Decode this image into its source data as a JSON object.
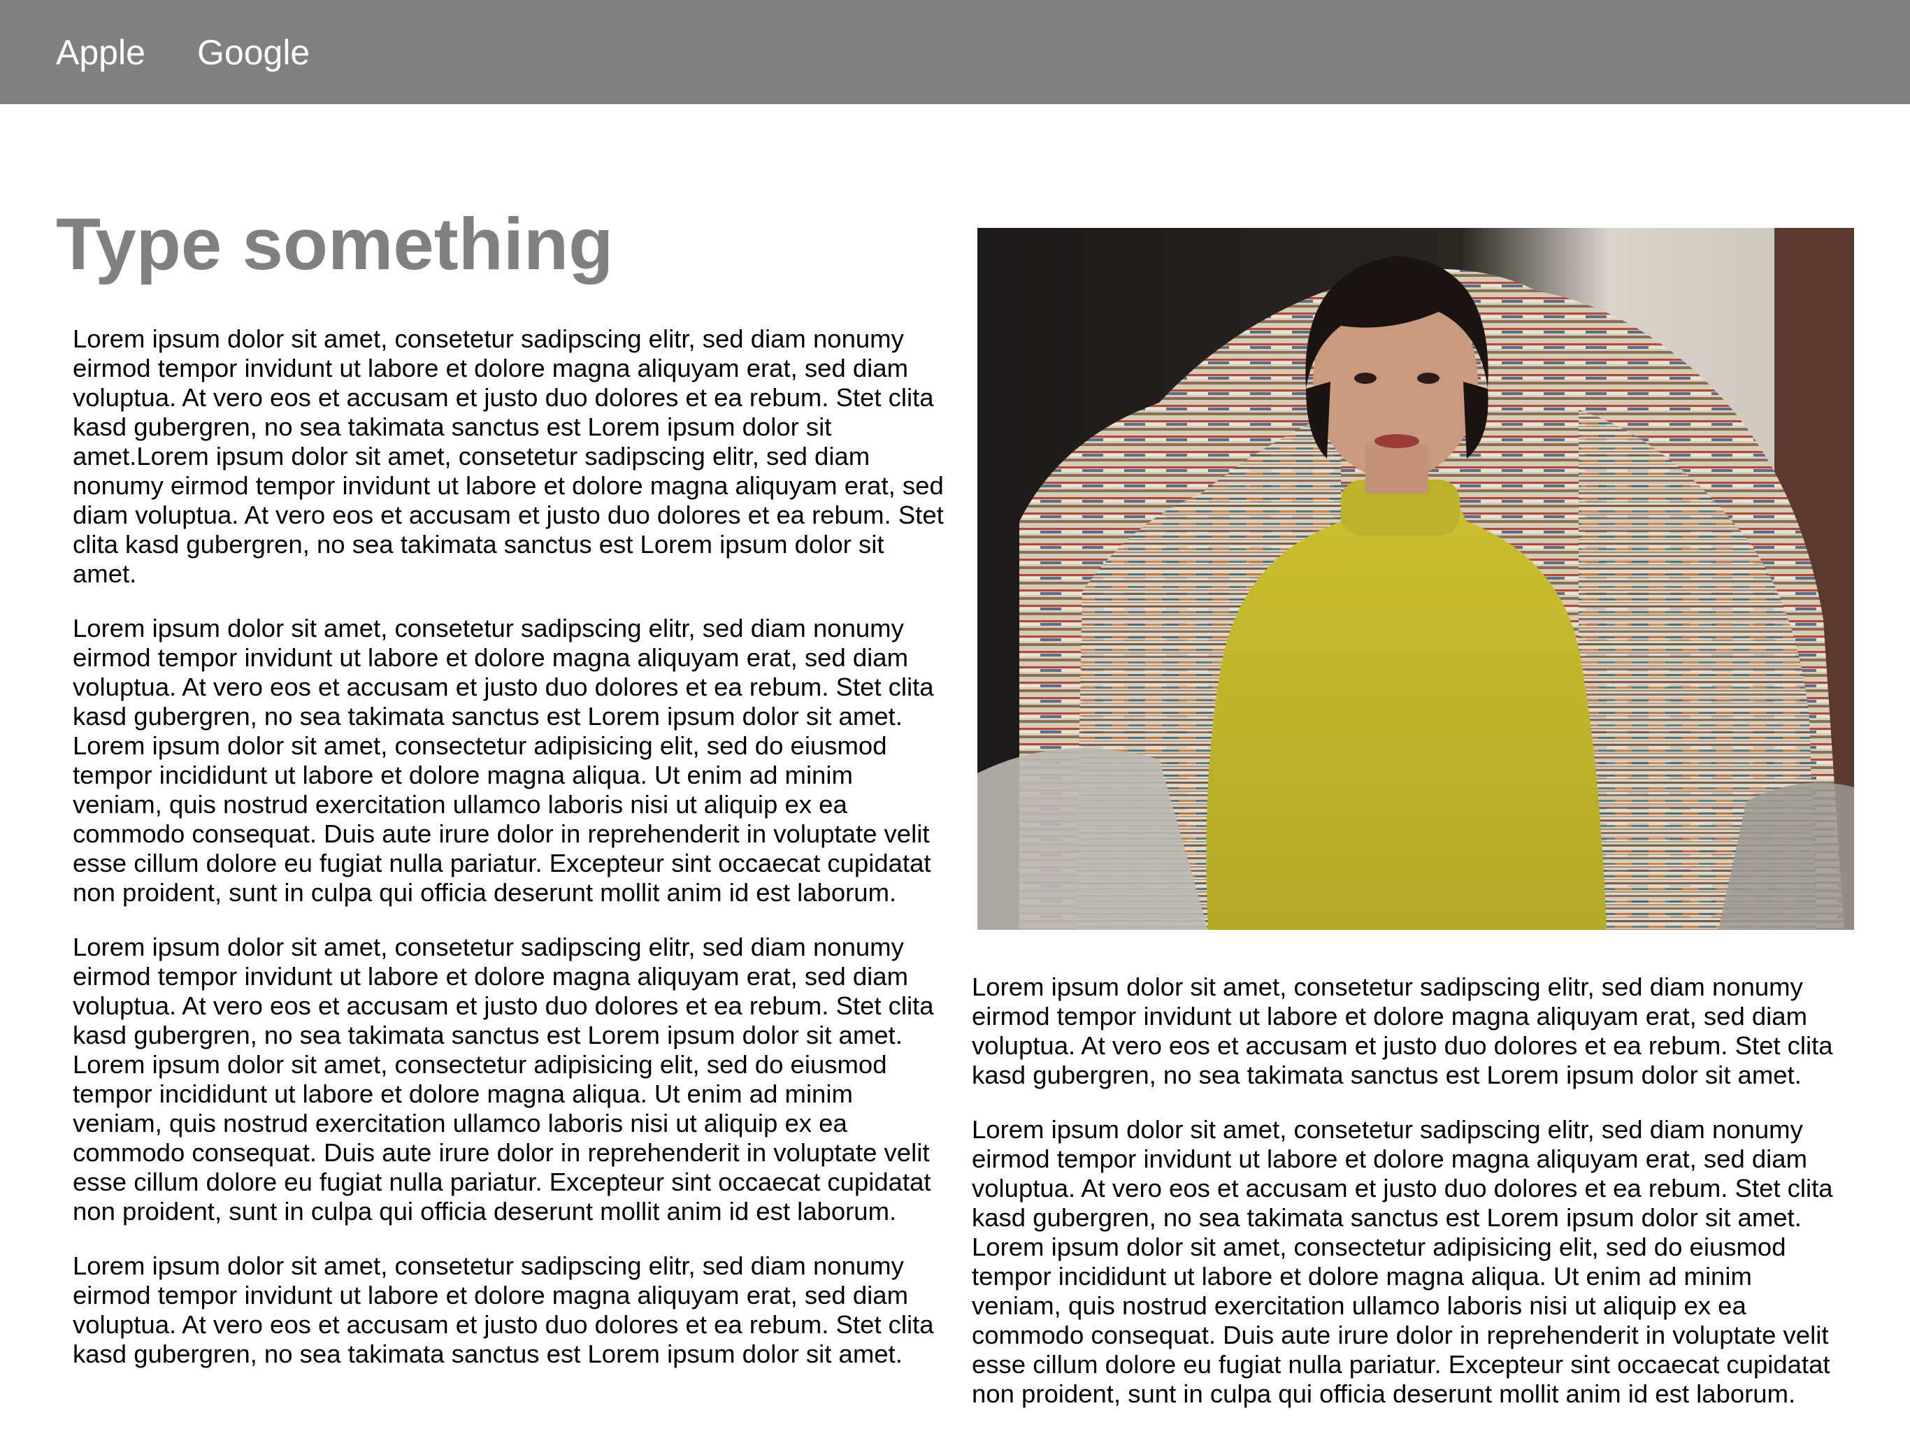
{
  "nav": {
    "links": [
      "Apple",
      "Google"
    ]
  },
  "page": {
    "title": "Type something"
  },
  "left_column": {
    "paragraphs": [
      "Lorem ipsum dolor sit amet, consetetur sadipscing elitr, sed diam nonumy eirmod tempor invidunt ut labore et dolore magna aliquyam erat, sed diam voluptua. At vero eos et accusam et justo duo dolores et ea rebum. Stet clita kasd gubergren, no sea takimata sanctus est Lorem ipsum dolor sit amet.Lorem ipsum dolor sit amet, consetetur sadipscing elitr, sed diam nonumy eirmod tempor invidunt ut labore et dolore magna aliquyam erat, sed diam voluptua. At vero eos et accusam et justo duo dolores et ea rebum. Stet clita kasd gubergren, no sea takimata sanctus est Lorem ipsum dolor sit amet.",
      "Lorem ipsum dolor sit amet, consetetur sadipscing elitr, sed diam nonumy eirmod tempor invidunt ut labore et dolore magna aliquyam erat, sed diam voluptua. At vero eos et accusam et justo duo dolores et ea rebum. Stet clita kasd gubergren, no sea takimata sanctus est Lorem ipsum dolor sit amet. Lorem ipsum dolor sit amet, consectetur adipisicing elit, sed do eiusmod tempor incididunt ut labore et dolore magna aliqua. Ut enim ad minim veniam, quis nostrud exercitation ullamco laboris nisi ut aliquip ex ea commodo consequat. Duis aute irure dolor in reprehenderit in voluptate velit esse cillum dolore eu fugiat nulla pariatur. Excepteur sint occaecat cupidatat non proident, sunt in culpa qui officia deserunt mollit anim id est laborum.",
      "Lorem ipsum dolor sit amet, consetetur sadipscing elitr, sed diam nonumy eirmod tempor invidunt ut labore et dolore magna aliquyam erat, sed diam voluptua. At vero eos et accusam et justo duo dolores et ea rebum. Stet clita kasd gubergren, no sea takimata sanctus est Lorem ipsum dolor sit amet. Lorem ipsum dolor sit amet, consectetur adipisicing elit, sed do eiusmod tempor incididunt ut labore et dolore magna aliqua. Ut enim ad minim veniam, quis nostrud exercitation ullamco laboris nisi ut aliquip ex ea commodo consequat. Duis aute irure dolor in reprehenderit in voluptate velit esse cillum dolore eu fugiat nulla pariatur. Excepteur sint occaecat cupidatat non proident, sunt in culpa qui officia deserunt mollit anim id est laborum.",
      "Lorem ipsum dolor sit amet, consetetur sadipscing elitr, sed diam nonumy eirmod tempor invidunt ut labore et dolore magna aliquyam erat, sed diam voluptua. At vero eos et accusam et justo duo dolores et ea rebum. Stet clita kasd gubergren, no sea takimata sanctus est Lorem ipsum dolor sit amet."
    ]
  },
  "right_column": {
    "paragraphs": [
      "Lorem ipsum dolor sit amet, consetetur sadipscing elitr, sed diam nonumy eirmod tempor invidunt ut labore et dolore magna aliquyam erat, sed diam voluptua. At vero eos et accusam et justo duo dolores et ea rebum. Stet clita kasd gubergren, no sea takimata sanctus est Lorem ipsum dolor sit amet.",
      "Lorem ipsum dolor sit amet, consetetur sadipscing elitr, sed diam nonumy eirmod tempor invidunt ut labore et dolore magna aliquyam erat, sed diam voluptua. At vero eos et accusam et justo duo dolores et ea rebum. Stet clita kasd gubergren, no sea takimata sanctus est Lorem ipsum dolor sit amet. Lorem ipsum dolor sit amet, consectetur adipisicing elit, sed do eiusmod tempor incididunt ut labore et dolore magna aliqua. Ut enim ad minim veniam, quis nostrud exercitation ullamco laboris nisi ut aliquip ex ea commodo consequat. Duis aute irure dolor in reprehenderit in voluptate velit esse cillum dolore eu fugiat nulla pariatur. Excepteur sint occaecat cupidatat non proident, sunt in culpa qui officia deserunt mollit anim id est laborum."
    ]
  },
  "colors": {
    "navbar_background": "#808080",
    "nav_text": "#ffffff",
    "title_text": "#808080",
    "body_text": "#000000",
    "page_background": "#ffffff"
  }
}
